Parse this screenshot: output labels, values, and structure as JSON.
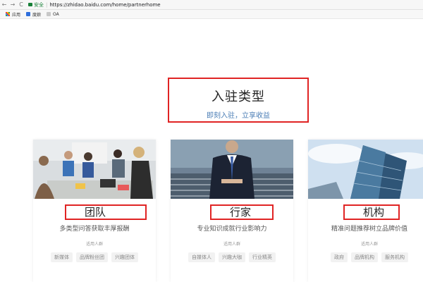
{
  "browser": {
    "back": "←",
    "forward": "→",
    "reload": "C",
    "security_label": "安全",
    "url": "https://zhidao.baidu.com/home/partnerhome"
  },
  "bookmarks": [
    {
      "label": "应用",
      "icon": "apps-grid-icon"
    },
    {
      "label": "度娘",
      "icon": "paw-icon"
    },
    {
      "label": "OA",
      "icon": "bookmark-icon"
    }
  ],
  "hero": {
    "title": "入驻类型",
    "subtitle": "即刻入驻，立享收益"
  },
  "cards": [
    {
      "name": "团队",
      "description": "多类型问答获取丰厚报酬",
      "audience_label": "适用人群",
      "tags": [
        "新媒体",
        "品牌粉丝团",
        "兴趣团体"
      ]
    },
    {
      "name": "行家",
      "description": "专业知识成就行业影响力",
      "audience_label": "适用人群",
      "tags": [
        "自媒体人",
        "兴趣大咖",
        "行业精英"
      ]
    },
    {
      "name": "机构",
      "description": "精准问题推荐树立品牌价值",
      "audience_label": "适用人群",
      "tags": [
        "政府",
        "品牌机构",
        "服务机构"
      ]
    }
  ],
  "colors": {
    "highlight_red": "#e02424",
    "subtitle_blue": "#4a7db5",
    "secure_green": "#188038"
  }
}
